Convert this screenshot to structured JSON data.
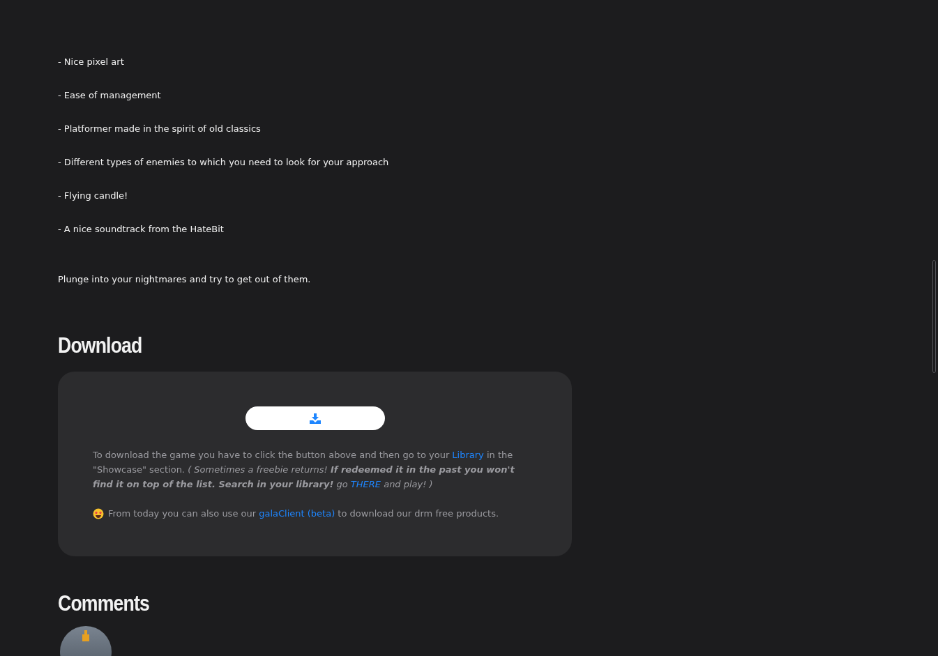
{
  "features": [
    "- Nice pixel art",
    "- Ease of management",
    "- Platformer made in the spirit of old classics",
    "- Different types of enemies to which you need to look for your approach",
    "- Flying candle!",
    "- A nice soundtrack from the HateBit"
  ],
  "closing_text": "Plunge into your nightmares and try to get out of them.",
  "download": {
    "heading": "Download",
    "instructions": [
      {
        "kind": "text",
        "italic": false,
        "text": "To download the game you have to click the button above and then go to your "
      },
      {
        "kind": "link",
        "italic": false,
        "text": "Library"
      },
      {
        "kind": "text",
        "italic": false,
        "text": " in the \"Showcase\" section. "
      },
      {
        "kind": "text",
        "italic": true,
        "text": "( Sometimes a freebie returns! **If redeemed it in the past you won't find it on top of the list. Search in your library!** go "
      },
      {
        "kind": "link",
        "italic": true,
        "text": "THERE"
      },
      {
        "kind": "text",
        "italic": true,
        "text": " and play! )"
      }
    ],
    "client_note": [
      {
        "kind": "text",
        "italic": false,
        "text": "From today you can also use our "
      },
      {
        "kind": "link",
        "italic": false,
        "text": "galaClient (beta)"
      },
      {
        "kind": "text",
        "italic": false,
        "text": " to download our drm free products."
      }
    ]
  },
  "comments": {
    "heading": "Comments"
  }
}
